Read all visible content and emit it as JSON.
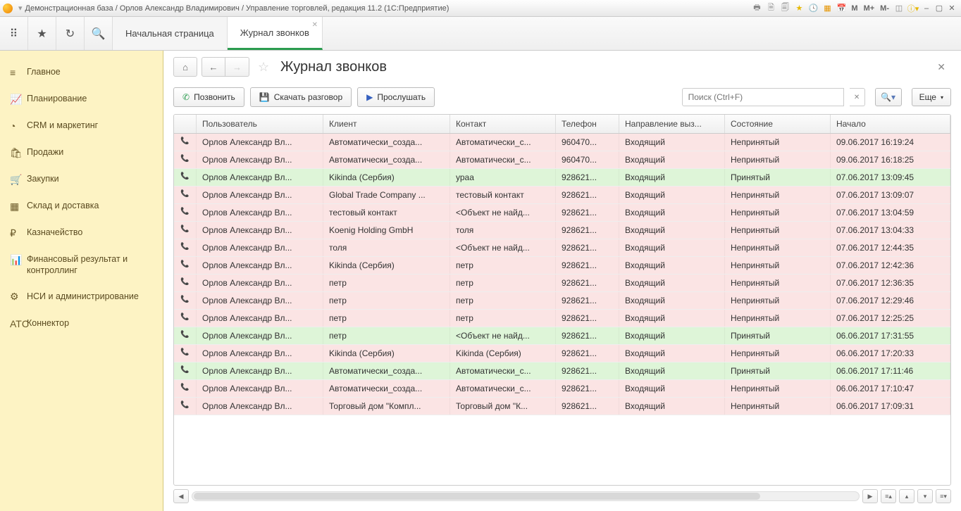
{
  "window_title": "Демонстрационная база / Орлов Александр Владимирович / Управление торговлей, редакция 11.2  (1С:Предприятие)",
  "mem_buttons": [
    "M",
    "M+",
    "M-"
  ],
  "tabs": {
    "home": "Начальная страница",
    "active": "Журнал звонков"
  },
  "page_title": "Журнал звонков",
  "toolbar": {
    "call": "Позвонить",
    "download": "Скачать разговор",
    "listen": "Прослушать",
    "search_placeholder": "Поиск (Ctrl+F)",
    "more": "Еще"
  },
  "sidebar": [
    {
      "icon": "≡",
      "label": "Главное"
    },
    {
      "icon": "📈",
      "label": "Планирование"
    },
    {
      "icon": "◔",
      "label": "CRM и маркетинг"
    },
    {
      "icon": "🛍",
      "label": "Продажи"
    },
    {
      "icon": "🛒",
      "label": "Закупки"
    },
    {
      "icon": "▦",
      "label": "Склад и доставка"
    },
    {
      "icon": "₽",
      "label": "Казначейство"
    },
    {
      "icon": "📊",
      "label": "Финансовый результат и контроллинг"
    },
    {
      "icon": "⚙",
      "label": "НСИ и администрирование"
    },
    {
      "icon": "ATC",
      "label": "Коннектор"
    }
  ],
  "columns": [
    "Пользователь",
    "Клиент",
    "Контакт",
    "Телефон",
    "Направление выз...",
    "Состояние",
    "Начало"
  ],
  "rows": [
    {
      "s": "red",
      "u": "Орлов Александр Вл...",
      "c": "Автоматически_созда...",
      "k": "Автоматически_с...",
      "p": "960470...",
      "d": "Входящий",
      "st": "Непринятый",
      "t": "09.06.2017 16:19:24"
    },
    {
      "s": "red",
      "u": "Орлов Александр Вл...",
      "c": "Автоматически_созда...",
      "k": "Автоматически_с...",
      "p": "960470...",
      "d": "Входящий",
      "st": "Непринятый",
      "t": "09.06.2017 16:18:25"
    },
    {
      "s": "green",
      "u": "Орлов Александр Вл...",
      "c": "Kikinda (Сербия)",
      "k": "ураа",
      "p": "928621...",
      "d": "Входящий",
      "st": "Принятый",
      "t": "07.06.2017 13:09:45"
    },
    {
      "s": "red",
      "u": "Орлов Александр Вл...",
      "c": "Global Trade Company ...",
      "k": "тестовый контакт",
      "p": "928621...",
      "d": "Входящий",
      "st": "Непринятый",
      "t": "07.06.2017 13:09:07"
    },
    {
      "s": "red",
      "u": "Орлов Александр Вл...",
      "c": "тестовый контакт",
      "k": "<Объект не найд...",
      "p": "928621...",
      "d": "Входящий",
      "st": "Непринятый",
      "t": "07.06.2017 13:04:59"
    },
    {
      "s": "red",
      "u": "Орлов Александр Вл...",
      "c": "Koenig Holding GmbH",
      "k": "толя",
      "p": "928621...",
      "d": "Входящий",
      "st": "Непринятый",
      "t": "07.06.2017 13:04:33"
    },
    {
      "s": "red",
      "u": "Орлов Александр Вл...",
      "c": "толя",
      "k": "<Объект не найд...",
      "p": "928621...",
      "d": "Входящий",
      "st": "Непринятый",
      "t": "07.06.2017 12:44:35"
    },
    {
      "s": "red",
      "u": "Орлов Александр Вл...",
      "c": "Kikinda (Сербия)",
      "k": "петр",
      "p": "928621...",
      "d": "Входящий",
      "st": "Непринятый",
      "t": "07.06.2017 12:42:36"
    },
    {
      "s": "red",
      "u": "Орлов Александр Вл...",
      "c": "петр",
      "k": "петр",
      "p": "928621...",
      "d": "Входящий",
      "st": "Непринятый",
      "t": "07.06.2017 12:36:35"
    },
    {
      "s": "red",
      "u": "Орлов Александр Вл...",
      "c": "петр",
      "k": "петр",
      "p": "928621...",
      "d": "Входящий",
      "st": "Непринятый",
      "t": "07.06.2017 12:29:46"
    },
    {
      "s": "red",
      "u": "Орлов Александр Вл...",
      "c": "петр",
      "k": "петр",
      "p": "928621...",
      "d": "Входящий",
      "st": "Непринятый",
      "t": "07.06.2017 12:25:25"
    },
    {
      "s": "green",
      "u": "Орлов Александр Вл...",
      "c": "петр",
      "k": "<Объект не найд...",
      "p": "928621...",
      "d": "Входящий",
      "st": "Принятый",
      "t": "06.06.2017 17:31:55"
    },
    {
      "s": "red",
      "u": "Орлов Александр Вл...",
      "c": "Kikinda (Сербия)",
      "k": "Kikinda (Сербия)",
      "p": "928621...",
      "d": "Входящий",
      "st": "Непринятый",
      "t": "06.06.2017 17:20:33"
    },
    {
      "s": "green",
      "u": "Орлов Александр Вл...",
      "c": "Автоматически_созда...",
      "k": "Автоматически_с...",
      "p": "928621...",
      "d": "Входящий",
      "st": "Принятый",
      "t": "06.06.2017 17:11:46"
    },
    {
      "s": "red",
      "u": "Орлов Александр Вл...",
      "c": "Автоматически_созда...",
      "k": "Автоматически_с...",
      "p": "928621...",
      "d": "Входящий",
      "st": "Непринятый",
      "t": "06.06.2017 17:10:47"
    },
    {
      "s": "red",
      "u": "Орлов Александр Вл...",
      "c": "Торговый дом \"Компл...",
      "k": "Торговый дом \"К...",
      "p": "928621...",
      "d": "Входящий",
      "st": "Непринятый",
      "t": "06.06.2017 17:09:31"
    }
  ]
}
